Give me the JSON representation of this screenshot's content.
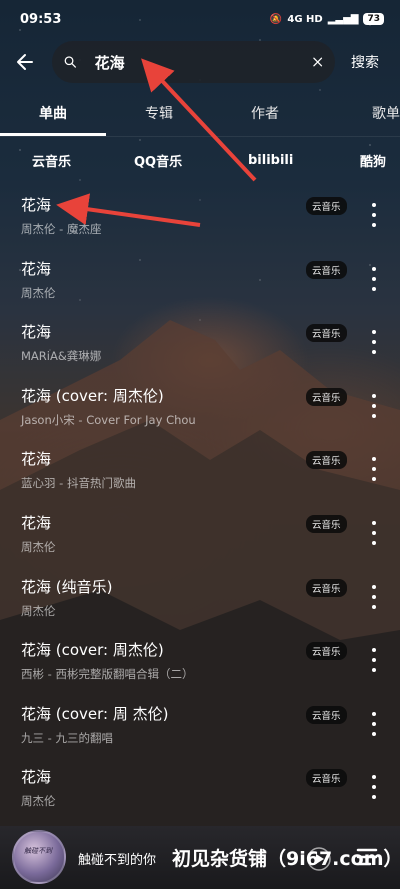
{
  "status_bar": {
    "time": "09:53",
    "network": "4G HD",
    "battery": "73"
  },
  "search": {
    "query": "花海",
    "submit_label": "搜索"
  },
  "tabs": [
    {
      "label": "单曲",
      "active": true
    },
    {
      "label": "专辑",
      "active": false
    },
    {
      "label": "作者",
      "active": false
    },
    {
      "label": "歌单",
      "active": false
    }
  ],
  "sources": [
    {
      "label": "云音乐",
      "active": true
    },
    {
      "label": "QQ音乐",
      "active": false
    },
    {
      "label": "bilibili",
      "active": false
    },
    {
      "label": "酷狗",
      "active": false
    }
  ],
  "songs": [
    {
      "title": "花海",
      "subtitle": "周杰伦 - 魔杰座",
      "badge": "云音乐"
    },
    {
      "title": "花海",
      "subtitle": "周杰伦",
      "badge": "云音乐"
    },
    {
      "title": "花海",
      "subtitle": "MARiA&龚琳娜",
      "badge": "云音乐"
    },
    {
      "title": "花海 (cover: 周杰伦)",
      "subtitle": "Jason小宋 - Cover For Jay Chou",
      "badge": "云音乐"
    },
    {
      "title": "花海",
      "subtitle": "蓝心羽 - 抖音热门歌曲",
      "badge": "云音乐"
    },
    {
      "title": "花海",
      "subtitle": "周杰伦",
      "badge": "云音乐"
    },
    {
      "title": "花海 (纯音乐)",
      "subtitle": "周杰伦",
      "badge": "云音乐"
    },
    {
      "title": "花海 (cover: 周杰伦)",
      "subtitle": "西彬 - 西彬完整版翻唱合辑（二）",
      "badge": "云音乐"
    },
    {
      "title": "花海 (cover: 周 杰伦)",
      "subtitle": "九三 - 九三的翻唱",
      "badge": "云音乐"
    },
    {
      "title": "花海",
      "subtitle": "周杰伦",
      "badge": "云音乐"
    }
  ],
  "player": {
    "now_playing": "触碰不到的你",
    "watermark": "初见杂货铺（9i67.com）"
  },
  "colors": {
    "annotation_arrow": "#e8433a",
    "badge_bg": "#0a0a0a"
  }
}
